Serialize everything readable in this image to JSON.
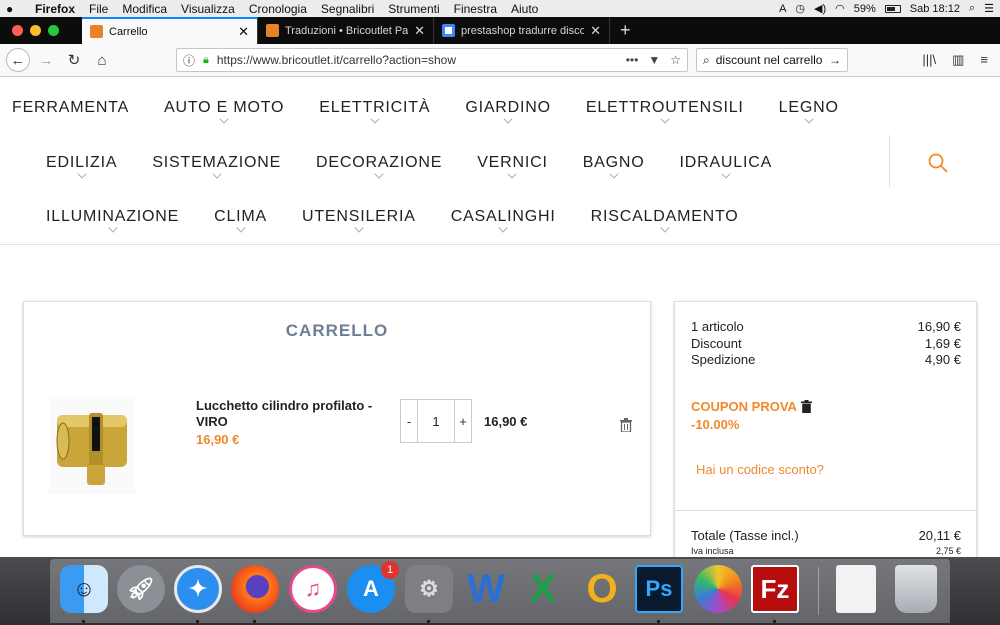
{
  "menubar": {
    "app": "Firefox",
    "items": [
      "File",
      "Modifica",
      "Visualizza",
      "Cronologia",
      "Segnalibri",
      "Strumenti",
      "Finestra",
      "Aiuto"
    ],
    "battery": "59%",
    "clock": "Sab 18:12"
  },
  "tabs": [
    {
      "title": "Carrello",
      "active": true
    },
    {
      "title": "Traduzioni • Bricoutlet Pavese B",
      "active": false
    },
    {
      "title": "prestashop tradurre discount b",
      "active": false
    }
  ],
  "toolbar": {
    "url": "https://www.bricoutlet.it/carrello?action=show",
    "search_value": "discount nel carrello"
  },
  "categories": {
    "row1": [
      "FERRAMENTA",
      "AUTO E MOTO",
      "ELETTRICITÀ",
      "GIARDINO",
      "ELETTROUTENSILI",
      "LEGNO"
    ],
    "row2": [
      "EDILIZIA",
      "SISTEMAZIONE",
      "DECORAZIONE",
      "VERNICI",
      "BAGNO",
      "IDRAULICA"
    ],
    "row3": [
      "ILLUMINAZIONE",
      "CLIMA",
      "UTENSILERIA",
      "CASALINGHI",
      "RISCALDAMENTO"
    ]
  },
  "cart": {
    "title": "CARRELLO",
    "product_name": "Lucchetto cilindro profilato - VIRO",
    "product_price": "16,90 €",
    "qty_minus": "-",
    "qty": "1",
    "qty_plus": "+",
    "line_total": "16,90 €"
  },
  "summary": {
    "items_label": "1 articolo",
    "items_value": "16,90 €",
    "discount_label": "Discount",
    "discount_value": "1,69 €",
    "shipping_label": "Spedizione",
    "shipping_value": "4,90 €",
    "coupon_name": "COUPON PROVA",
    "coupon_value": "-10.00%",
    "have_code": "Hai un codice sconto?",
    "total_label": "Totale (Tasse incl.)",
    "total_value": "20,11 €",
    "vat_label": "Iva inclusa",
    "vat_value": "2,75 €"
  },
  "dock": {
    "appstore_badge": "1",
    "apps": [
      "finder",
      "launchpad",
      "safari",
      "firefox",
      "itunes",
      "app-store",
      "system-preferences",
      "word",
      "excel",
      "outlook",
      "photoshop",
      "photos",
      "filezilla",
      "document",
      "trash"
    ]
  },
  "colors": {
    "accent": "#f08a2a",
    "title": "#6e7f95"
  }
}
